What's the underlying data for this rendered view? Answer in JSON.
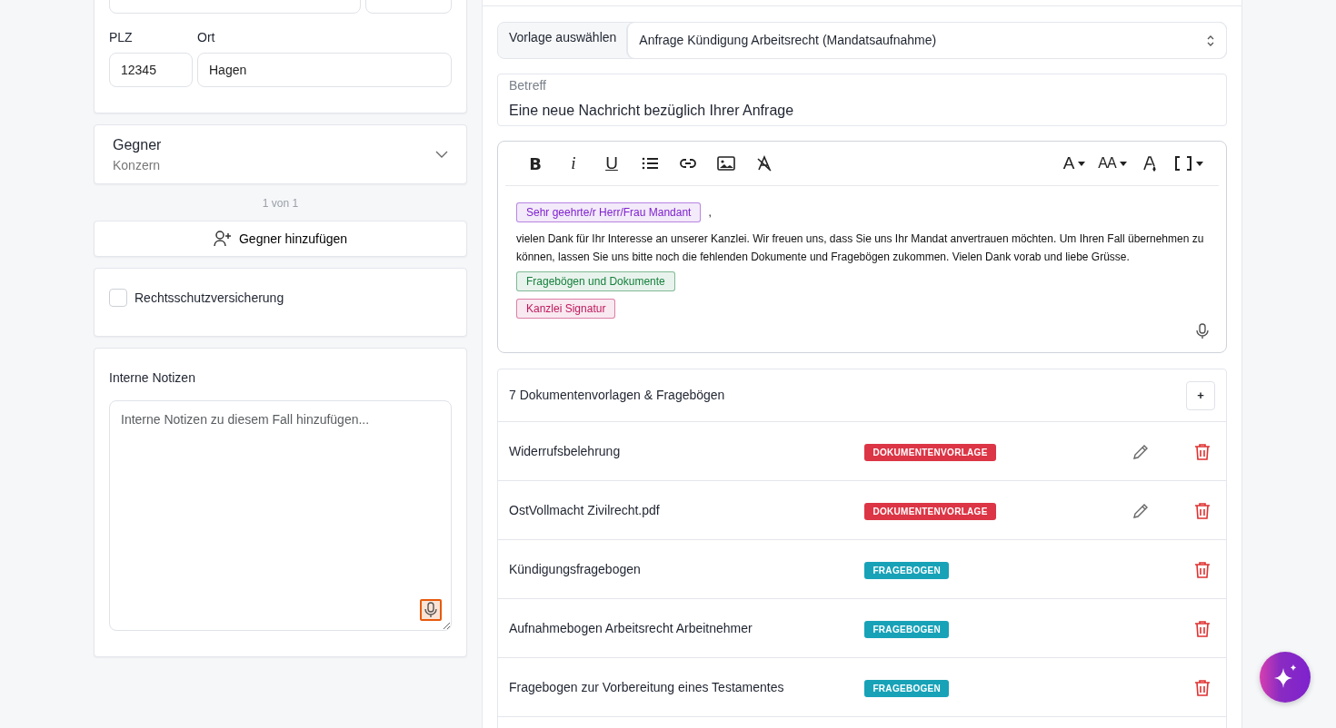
{
  "address": {
    "plz_label": "PLZ",
    "plz": "12345",
    "ort_label": "Ort",
    "ort": "Hagen"
  },
  "opponent": {
    "title": "Gegner",
    "subtitle": "Konzern",
    "expanded": false
  },
  "pager": "1 von 1",
  "add_opponent": "Gegner hinzufügen",
  "insurance": {
    "label": "Rechtsschutzversicherung",
    "checked": false
  },
  "notes": {
    "label": "Interne Notizen",
    "placeholder": "Interne Notizen zu diesem Fall hinzufügen...",
    "mic_highlighted": true
  },
  "template": {
    "label": "Vorlage auswählen",
    "value": "Anfrage Kündigung Arbeitsrecht (Mandatsaufnahme)"
  },
  "subject": {
    "label": "Betreff",
    "value": "Eine neue Nachricht bezüglich Ihrer Anfrage"
  },
  "editor": {
    "format_buttons": [
      "B",
      "i",
      "U"
    ],
    "font_buttons": [
      "A",
      "AA"
    ],
    "salutation": {
      "text": "Sehr geehrte/r Herr/Frau Mandant",
      "color": "#7e22ce"
    },
    "comma": ",",
    "body": "vielen Dank für Ihr Interesse an unserer Kanzlei. Wir freuen uns, dass Sie uns Ihr Mandat anvertrauen möchten. Um Ihren Fall übernehmen zu können, lassen Sie uns bitte noch die fehlenden Dokumente und Fragebögen zukommen. Vielen Dank vorab und liebe Grüsse.",
    "tags": [
      {
        "text": "Fragebögen und Dokumente",
        "color": "#15803d"
      },
      {
        "text": "Kanzlei Signatur",
        "color": "#be185d"
      }
    ]
  },
  "documents": {
    "title": "7 Dokumentenvorlagen & Fragebögen",
    "add": "+",
    "rows": [
      {
        "name": "Widerrufsbelehrung",
        "badge": "DOKUMENTENVORLAGE",
        "kind": "document",
        "editable": true
      },
      {
        "name": "OstVollmacht Zivilrecht.pdf",
        "badge": "DOKUMENTENVORLAGE",
        "kind": "document",
        "editable": true
      },
      {
        "name": "Kündigungsfragebogen",
        "badge": "FRAGEBOGEN",
        "kind": "questionnaire",
        "editable": false
      },
      {
        "name": "Aufnahmebogen Arbeitsrecht Arbeitnehmer",
        "badge": "FRAGEBOGEN",
        "kind": "questionnaire",
        "editable": false
      },
      {
        "name": "Fragebogen zur Vorbereitung eines Testamentes",
        "badge": "FRAGEBOGEN",
        "kind": "questionnaire",
        "editable": false
      }
    ]
  }
}
